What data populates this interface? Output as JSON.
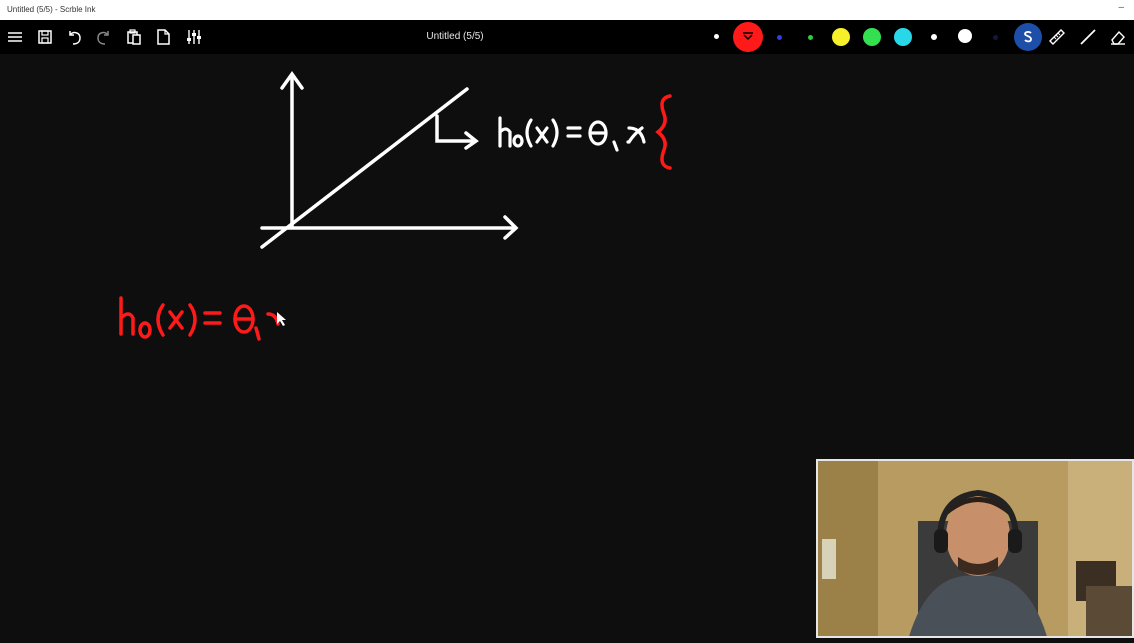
{
  "window": {
    "title": "Untitled (5/5) - Scrble Ink",
    "minimize_glyph": "–"
  },
  "toolbar": {
    "document_title": "Untitled (5/5)",
    "icons": [
      "menu-icon",
      "save-icon",
      "undo-icon",
      "redo-icon",
      "paste-icon",
      "new-page-icon",
      "settings-sliders-icon"
    ],
    "pen_colors": [
      {
        "name": "white-small",
        "color": "#ffffff"
      },
      {
        "name": "red",
        "color": "#ff1a1a",
        "selected": true
      },
      {
        "name": "blue",
        "color": "#2f3fe8"
      },
      {
        "name": "green-small",
        "color": "#2ecc40"
      },
      {
        "name": "yellow",
        "color": "#f5f02a"
      },
      {
        "name": "green",
        "color": "#33e050"
      },
      {
        "name": "cyan",
        "color": "#29d8e8"
      },
      {
        "name": "white-dot",
        "color": "#ffffff"
      },
      {
        "name": "white",
        "color": "#ffffff"
      },
      {
        "name": "navy",
        "color": "#101840"
      }
    ],
    "tools": [
      "shape-tool-icon",
      "ruler-icon",
      "line-tool-icon",
      "eraser-icon"
    ]
  },
  "canvas": {
    "background": "#0e0e0e",
    "ink_white": "#ffffff",
    "ink_red": "#ff1a1a",
    "annotation_top": "hθ(x) = θ₁x",
    "annotation_bottom": "hθ(x) = θ₁x"
  },
  "webcam": {
    "visible": true
  }
}
